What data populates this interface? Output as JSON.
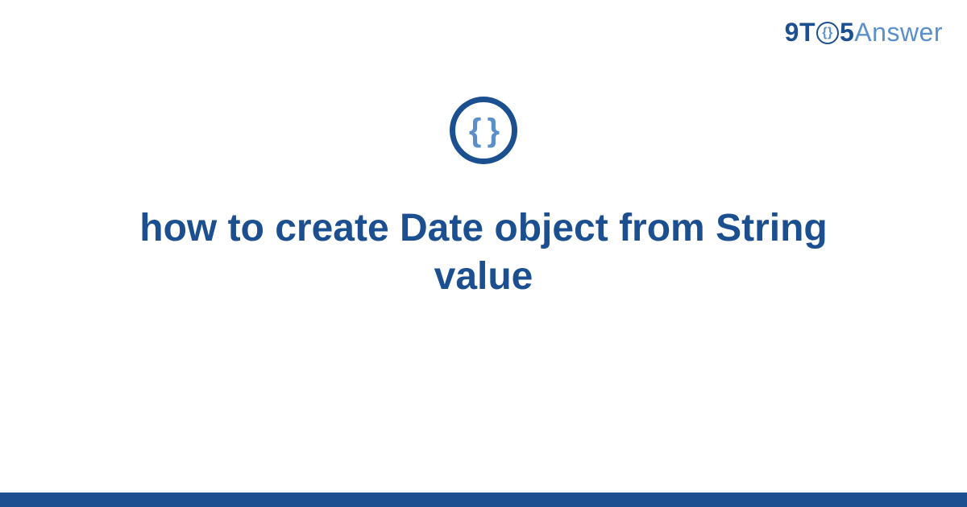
{
  "header": {
    "logo": {
      "prefix_9t": "9T",
      "circle_content": "{}",
      "suffix_5": "5",
      "answer": "Answer"
    }
  },
  "main": {
    "icon_braces": "{ }",
    "title": "how to create Date object from String value"
  }
}
